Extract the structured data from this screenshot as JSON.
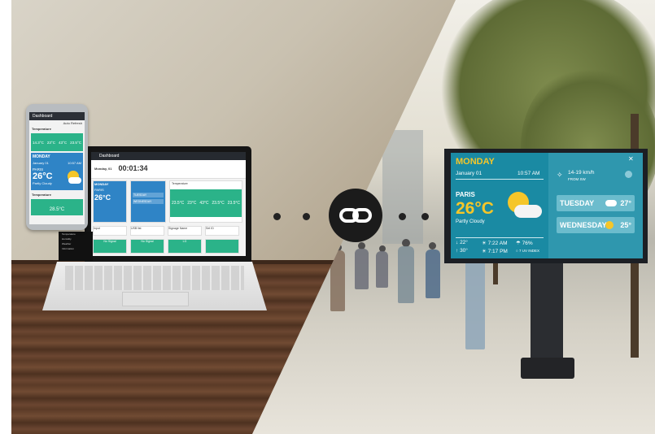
{
  "connector": {
    "icon": "link-icon"
  },
  "phone": {
    "title": "Dashboard",
    "toggle_label": "Auto Refresh",
    "section_temperature": "Temperature",
    "temps": [
      "14.3°C",
      "23°C",
      "43°C",
      "23.5°C"
    ],
    "day": "MONDAY",
    "date": "January 01",
    "time": "10:57 AM",
    "city": "PARIS",
    "temp": "26°C",
    "condition": "Partly Cloudy",
    "section_2": "Temperature",
    "footer_temp": "28.5°C"
  },
  "laptop": {
    "title": "Dashboard",
    "date": "Monday, 01",
    "timer": "00:01:34",
    "day": "MONDAY",
    "city": "PARIS",
    "temp": "26°C",
    "section_temperature": "Temperature",
    "temps": [
      "23.5°C",
      "23°C",
      "43°C",
      "23.5°C",
      "23.5°C"
    ],
    "forecast": [
      "TUESDAY",
      "WEDNESDAY"
    ],
    "side_items": [
      "Temperature",
      "Humidity",
      "Weather",
      "Information"
    ],
    "tiles": [
      "No Signal",
      "No Signal",
      "LG"
    ],
    "cards": [
      "Input",
      "USB list",
      "Signage Name",
      "Set ID"
    ]
  },
  "signage": {
    "day": "MONDAY",
    "date": "January 01",
    "time": "10:57 AM",
    "city": "PARIS",
    "temp": "26°C",
    "condition": "Partly Cloudy",
    "wind": "14-19 km/h",
    "wind_dir": "FROM SW",
    "low": "22°",
    "high": "30°",
    "sunrise": "7:22 AM",
    "sunset": "7:17 PM",
    "humidity": "76%",
    "uv": "7 UV INDEX",
    "forecast": [
      {
        "day": "TUESDAY",
        "temp": "27°",
        "icon": "cloud-icon"
      },
      {
        "day": "WEDNESDAY",
        "temp": "25°",
        "icon": "partly-sunny-icon"
      }
    ],
    "colors": {
      "panel": "#2f97ae",
      "accent": "#f5c629"
    }
  }
}
